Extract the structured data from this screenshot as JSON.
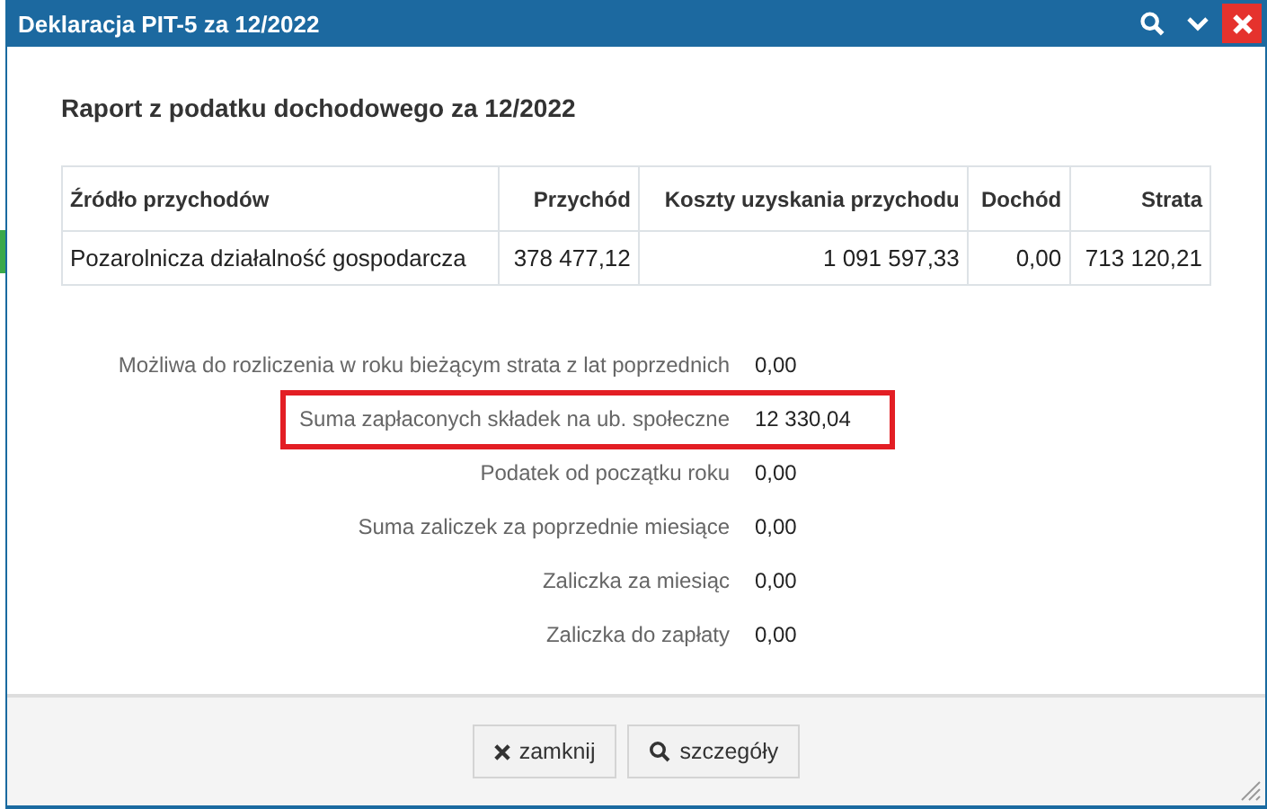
{
  "window": {
    "title": "Deklaracja PIT-5 za 12/2022"
  },
  "report": {
    "heading": "Raport z podatku dochodowego za 12/2022"
  },
  "table": {
    "columns": [
      "Źródło przychodów",
      "Przychód",
      "Koszty uzyskania przychodu",
      "Dochód",
      "Strata"
    ],
    "rows": [
      [
        "Pozarolnicza działalność gospodarcza",
        "378 477,12",
        "1 091 597,33",
        "0,00",
        "713 120,21"
      ]
    ]
  },
  "summary": [
    {
      "label": "Możliwa do rozliczenia w roku bieżącym strata z lat poprzednich",
      "value": "0,00",
      "highlighted": false
    },
    {
      "label": "Suma zapłaconych składek na ub. społeczne",
      "value": "12 330,04",
      "highlighted": true
    },
    {
      "label": "Podatek od początku roku",
      "value": "0,00",
      "highlighted": false
    },
    {
      "label": "Suma zaliczek za poprzednie miesiące",
      "value": "0,00",
      "highlighted": false
    },
    {
      "label": "Zaliczka za miesiąc",
      "value": "0,00",
      "highlighted": false
    },
    {
      "label": "Zaliczka do zapłaty",
      "value": "0,00",
      "highlighted": false
    }
  ],
  "buttons": [
    {
      "kind": "close",
      "label": "zamknij"
    },
    {
      "kind": "details",
      "label": "szczegóły"
    }
  ]
}
